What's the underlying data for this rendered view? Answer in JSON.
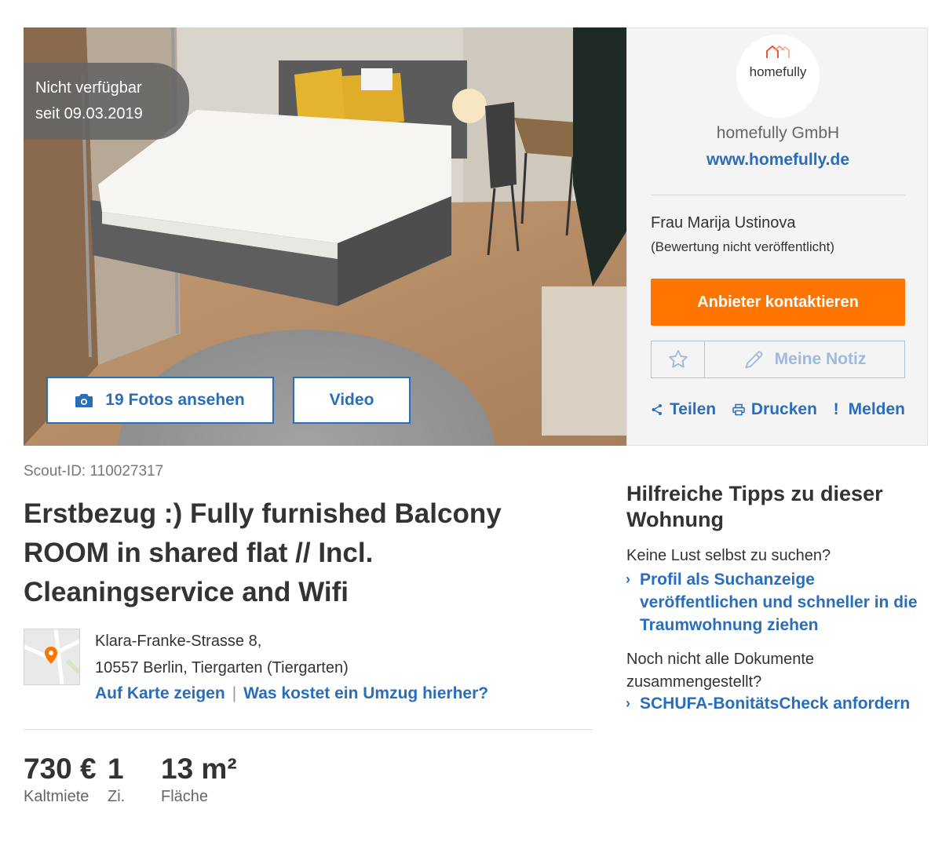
{
  "photo": {
    "badge_line1": "Nicht verfügbar",
    "badge_line2": "seit 09.03.2019",
    "fotos_label": "19 Fotos ansehen",
    "video_label": "Video"
  },
  "provider": {
    "logo_text": "homefully",
    "company": "homefully GmbH",
    "website": "www.homefully.de",
    "agent": "Frau Marija Ustinova",
    "rating": "(Bewertung nicht veröffentlicht)",
    "contact_label": "Anbieter kontaktieren",
    "note_label": "Meine Notiz",
    "actions": {
      "share": "Teilen",
      "print": "Drucken",
      "report_mark": "!",
      "report": "Melden"
    }
  },
  "listing": {
    "scout_id": "Scout-ID: 110027317",
    "title": "Erstbezug :) Fully furnished Balcony ROOM in shared flat // Incl. Cleaningservice and Wifi",
    "address_line1": "Klara-Franke-Strasse 8,",
    "address_line2": "10557 Berlin, Tiergarten (Tiergarten)",
    "map_link": "Auf Karte zeigen",
    "separator": "|",
    "move_link": "Was kostet ein Umzug hierher?",
    "key_values": {
      "rent_value": "730 €",
      "rent_label": "Kaltmiete",
      "rooms_value": "1",
      "rooms_label": "Zi.",
      "area_value": "13 m²",
      "area_label": "Fläche"
    }
  },
  "tips": {
    "title": "Hilfreiche Tipps zu dieser Wohnung",
    "question1": "Keine Lust selbst zu suchen?",
    "link1": "Profil als Suchanzeige veröffentlichen und schneller in die Traumwohnung ziehen",
    "question2": "Noch nicht alle Dokumente zusammengestellt?",
    "link2": "SCHUFA-BonitätsCheck anfordern",
    "chevron": "›"
  },
  "colors": {
    "accent": "#2a6ebb",
    "cta": "#ff7500",
    "logo": "#e85a3c"
  }
}
